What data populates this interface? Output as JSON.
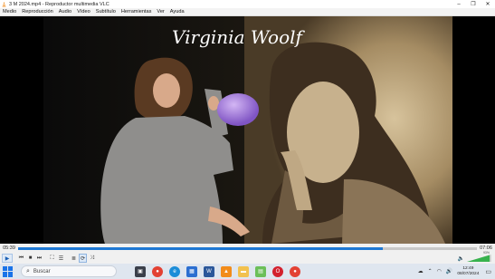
{
  "window": {
    "title": "3 M 2024.mp4 - Reproductor multimedia VLC"
  },
  "menu": [
    "Medio",
    "Reproducción",
    "Audio",
    "Vídeo",
    "Subtítulo",
    "Herramientas",
    "Ver",
    "Ayuda"
  ],
  "video": {
    "caption": "Virginia Woolf"
  },
  "playback": {
    "elapsed": "05:39",
    "duration": "07:06",
    "progress": 0.795
  },
  "volume": {
    "percent_label": "93%",
    "level": 0.93
  },
  "taskbar": {
    "search_placeholder": "Buscar",
    "time": "12:49",
    "date": "08/07/2024",
    "apps": [
      "task-view",
      "chrome",
      "edge",
      "store",
      "word",
      "vlc",
      "folder",
      "photos",
      "opera",
      "chrome-2"
    ]
  },
  "colors": {
    "accent": "#1e78d4",
    "sepia": "#b9a27a"
  }
}
